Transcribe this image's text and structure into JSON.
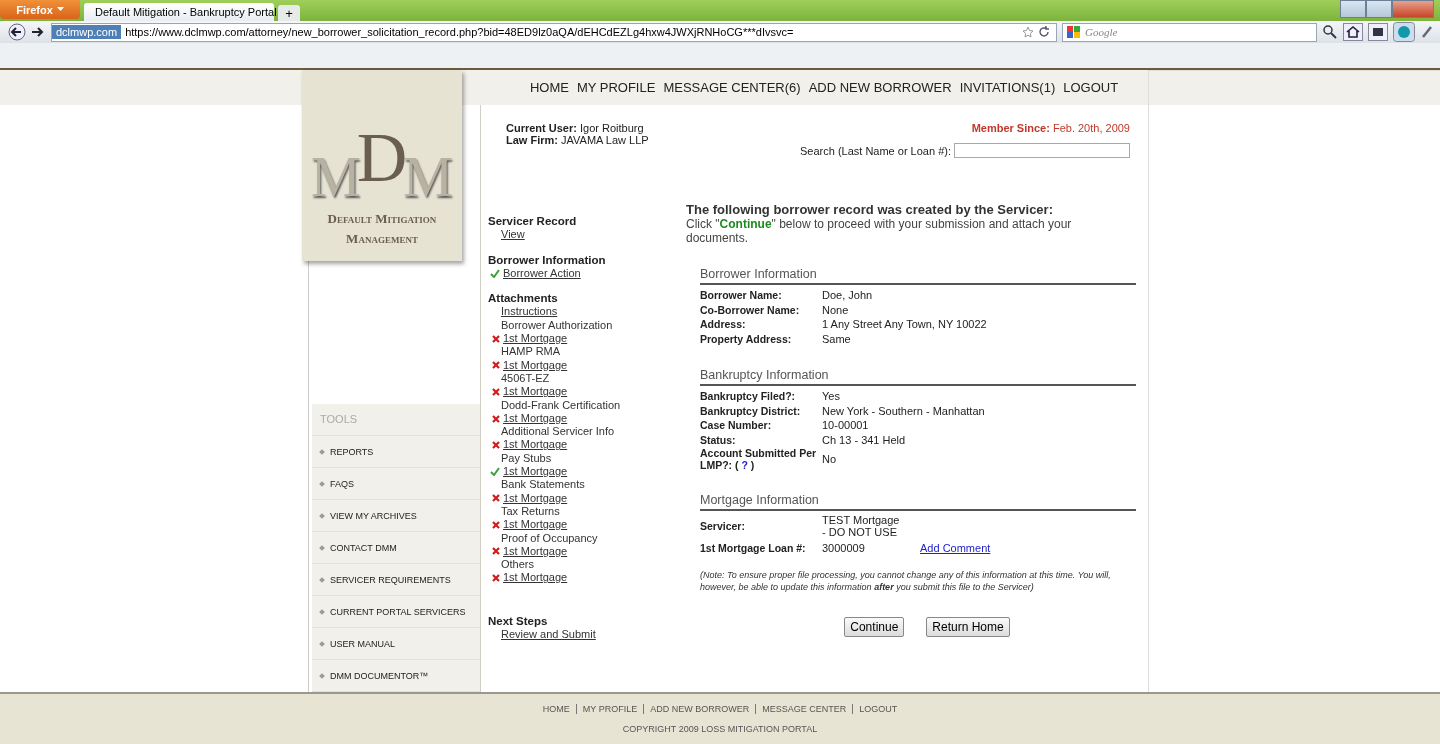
{
  "browser": {
    "menu_label": "Firefox",
    "tab_title": "Default Mitigation - Bankruptcy Portal",
    "new_tab": "+",
    "site_identity": "dclmwp.com",
    "url": "https://www.dclmwp.com/attorney/new_borrower_solicitation_record.php?bid=48ED9lz0aQA/dEHCdEZLg4hxw4JWXjRNHoCG***dIvsvc=",
    "search_placeholder": "Google"
  },
  "top_nav": [
    "HOME",
    "MY PROFILE",
    "MESSAGE CENTER(6)",
    "ADD NEW BORROWER",
    "INVITATIONS(1)",
    "LOGOUT"
  ],
  "logo": {
    "monogram": [
      "M",
      "D",
      "M"
    ],
    "line_1": "Default Mitigation",
    "line_2": "Management"
  },
  "user": {
    "current_user_label": "Current User:",
    "current_user": "Igor Roitburg",
    "law_firm_label": "Law Firm:",
    "law_firm": "JAVAMA Law LLP",
    "member_since_label": "Member Since:",
    "member_since": "Feb. 20th, 2009",
    "search_label": "Search (Last Name or Loan #):"
  },
  "record_nav": [
    {
      "title": "Servicer Record",
      "items": [
        {
          "kind": "link",
          "text": "View"
        }
      ]
    },
    {
      "title": "Borrower Information",
      "items": [
        {
          "kind": "file",
          "text": "Borrower Action",
          "done": true
        }
      ]
    },
    {
      "title": "Attachments",
      "items": [
        {
          "kind": "link",
          "text": "Instructions"
        },
        {
          "kind": "label",
          "text": "Borrower Authorization"
        },
        {
          "kind": "file",
          "text": "1st Mortgage",
          "done": false
        },
        {
          "kind": "label",
          "text": "HAMP RMA"
        },
        {
          "kind": "file",
          "text": "1st Mortgage",
          "done": false
        },
        {
          "kind": "label",
          "text": "4506T-EZ"
        },
        {
          "kind": "file",
          "text": "1st Mortgage",
          "done": false
        },
        {
          "kind": "label",
          "text": "Dodd-Frank Certification"
        },
        {
          "kind": "file",
          "text": "1st Mortgage",
          "done": false
        },
        {
          "kind": "label",
          "text": "Additional Servicer Info"
        },
        {
          "kind": "file",
          "text": "1st Mortgage",
          "done": false
        },
        {
          "kind": "label",
          "text": "Pay Stubs"
        },
        {
          "kind": "file",
          "text": "1st Mortgage",
          "done": true
        },
        {
          "kind": "label",
          "text": "Bank Statements"
        },
        {
          "kind": "file",
          "text": "1st Mortgage",
          "done": false
        },
        {
          "kind": "label",
          "text": "Tax Returns"
        },
        {
          "kind": "file",
          "text": "1st Mortgage",
          "done": false
        },
        {
          "kind": "label",
          "text": "Proof of Occupancy"
        },
        {
          "kind": "file",
          "text": "1st Mortgage",
          "done": false
        },
        {
          "kind": "label",
          "text": "Others"
        },
        {
          "kind": "file",
          "text": "1st Mortgage",
          "done": false
        }
      ]
    },
    {
      "title": "Next Steps",
      "items": [
        {
          "kind": "link",
          "text": "Review and Submit"
        }
      ]
    }
  ],
  "tools": {
    "title": "TOOLS",
    "items": [
      "REPORTS",
      "FAQS",
      "VIEW MY ARCHIVES",
      "CONTACT DMM",
      "SERVICER REQUIREMENTS",
      "CURRENT PORTAL SERVICERS",
      "USER MANUAL",
      "DMM DOCUMENTOR™"
    ]
  },
  "record": {
    "heading": "The following borrower record was created by the Servicer:",
    "intro": "Click \"**Continue**\" below to proceed with your submission and attach your documents.",
    "sections": [
      {
        "title": "Borrower Information",
        "rows": [
          {
            "label": "Borrower Name:",
            "value": "Doe, John"
          },
          {
            "label": "Co-Borrower Name:",
            "value": "None"
          },
          {
            "label": "Address:",
            "value": "1 Any Street Any Town, NY 10022"
          },
          {
            "label": "Property Address:",
            "value": "Same"
          }
        ]
      },
      {
        "title": "Bankruptcy Information",
        "rows": [
          {
            "label": "Bankruptcy Filed?:",
            "value": "Yes"
          },
          {
            "label": "Bankruptcy District:",
            "value": "New York - Southern - Manhattan"
          },
          {
            "label": "Case Number:",
            "value": "10-00001"
          },
          {
            "label": "Status:",
            "value": "Ch 13 - 341 Held"
          },
          {
            "label": "Account Submitted Per LMP?: (",
            "help": "?",
            "label_end": ")",
            "value": "No"
          }
        ]
      },
      {
        "title": "Mortgage Information",
        "rows": [
          {
            "label": "Servicer:",
            "value": "TEST Mortgage - DO NOT USE"
          },
          {
            "label": "1st Mortgage Loan #:",
            "value": "3000009",
            "link": "Add Comment"
          }
        ]
      }
    ],
    "note": "(Note: To ensure proper file processing, you cannot change any of this information at this time. You will, however, be able to update this information **after** you submit this file to the Servicer)",
    "buttons": [
      "Continue",
      "Return Home"
    ]
  },
  "footer": {
    "links": [
      "HOME",
      "MY PROFILE",
      "ADD NEW BORROWER",
      "MESSAGE CENTER",
      "LOGOUT"
    ],
    "copyright": "COPYRIGHT 2009 LOSS MITIGATION PORTAL"
  }
}
